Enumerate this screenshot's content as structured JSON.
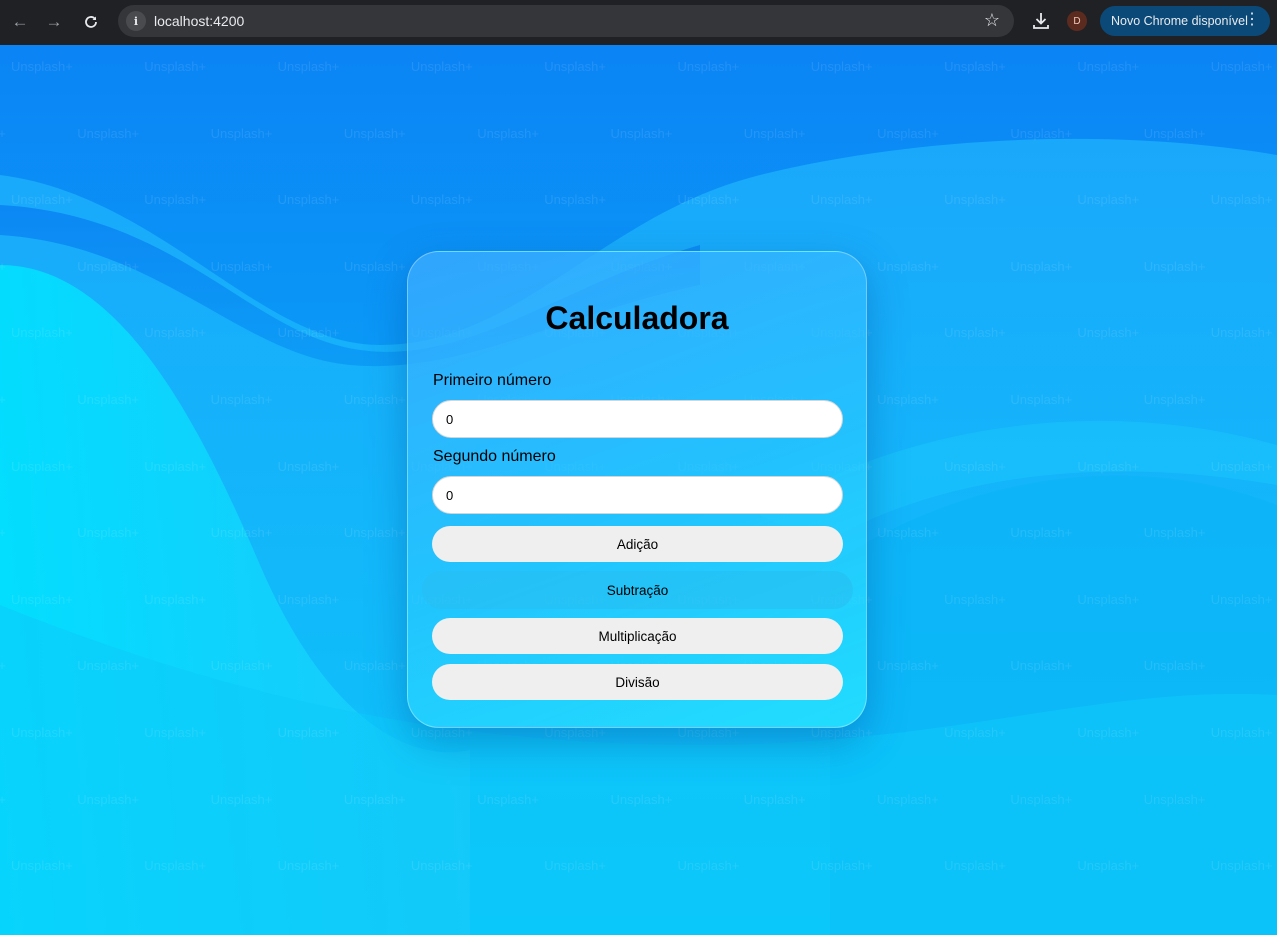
{
  "browser": {
    "url": "localhost:4200",
    "profile_initial": "D",
    "update_label": "Novo Chrome disponível",
    "icons": {
      "back": "arrow-left-icon",
      "forward": "arrow-right-icon",
      "reload": "reload-icon",
      "site_info": "info-icon",
      "bookmark": "star-icon",
      "download": "download-icon",
      "menu": "more-vert-icon"
    }
  },
  "background": {
    "watermark_text": "Unsplash+"
  },
  "calculator": {
    "title": "Calculadora",
    "first_label": "Primeiro número",
    "first_value": "0",
    "second_label": "Segundo número",
    "second_value": "0",
    "buttons": {
      "add": "Adição",
      "subtract": "Subtração",
      "multiply": "Multiplicação",
      "divide": "Divisão"
    },
    "hovered_button": "subtract"
  },
  "colors": {
    "chrome_bar": "#202124",
    "omnibox": "#35363a",
    "update_pill": "#0b4a78",
    "button_bg": "#efefef"
  }
}
